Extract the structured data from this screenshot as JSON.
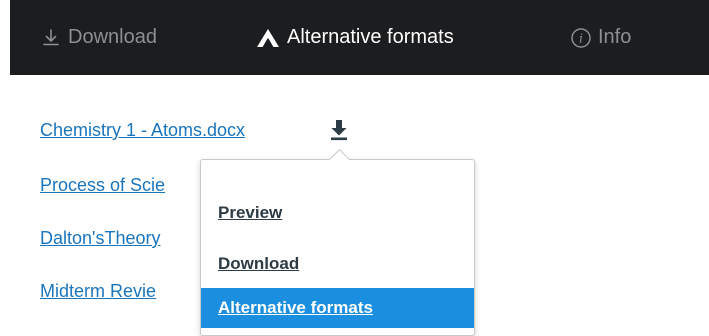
{
  "topbar": {
    "download_label": "Download",
    "alt_formats_label": "Alternative formats",
    "info_label": "Info"
  },
  "files": [
    {
      "name": "Chemistry 1 - Atoms.docx"
    },
    {
      "name": "Process of Scie"
    },
    {
      "name": "Dalton'sTheory"
    },
    {
      "name": "Midterm Revie"
    }
  ],
  "menu": {
    "items": [
      {
        "label": "Preview"
      },
      {
        "label": "Download"
      },
      {
        "label": "Alternative formats",
        "selected": true
      }
    ]
  },
  "colors": {
    "topbar_bg": "#1c1d1f",
    "link": "#1b75bc",
    "menu_selected_bg": "#1b8ee0"
  }
}
